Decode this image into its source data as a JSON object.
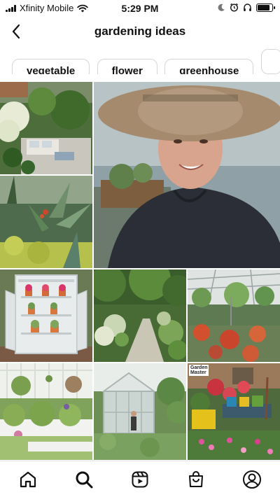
{
  "status_bar": {
    "carrier": "Xfinity Mobile",
    "time": "5:29 PM",
    "battery_level": 0.85
  },
  "header": {
    "title": "gardening ideas",
    "back_icon": "chevron-left-icon"
  },
  "chips": [
    {
      "label": "vegetable"
    },
    {
      "label": "flower"
    },
    {
      "label": "greenhouse"
    }
  ],
  "grid": {
    "items": [
      {
        "subject": "patio garden with white outdoor sofa"
      },
      {
        "subject": "woman in straw hat video"
      },
      {
        "subject": "tropical plants and agave garden"
      },
      {
        "subject": "white cabinet with potted flowers"
      },
      {
        "subject": "garden path between flower beds"
      },
      {
        "subject": "greenhouse interior with plants"
      },
      {
        "subject": "raised vegetable beds beside white fence"
      },
      {
        "subject": "person at glass greenhouse"
      },
      {
        "subject": "flower pots in garden center",
        "badge": "Garden Master"
      }
    ]
  },
  "bottom_nav": [
    {
      "icon": "home-icon"
    },
    {
      "icon": "search-icon"
    },
    {
      "icon": "reels-icon"
    },
    {
      "icon": "shop-icon"
    },
    {
      "icon": "profile-icon"
    }
  ]
}
